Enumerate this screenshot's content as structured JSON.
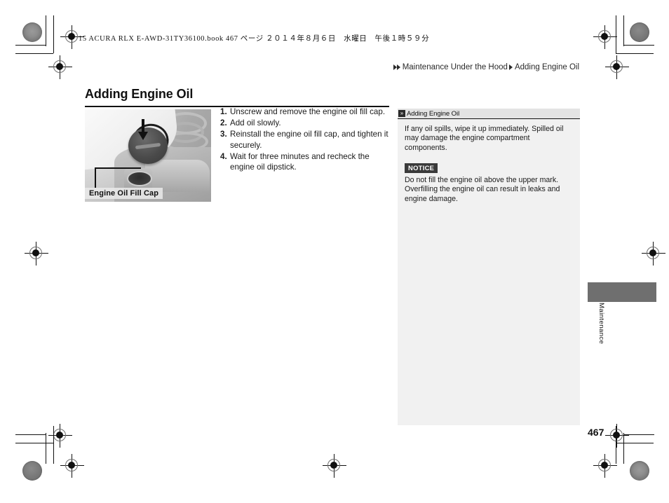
{
  "print_slug": {
    "plate_number": "15",
    "text": "15 ACURA RLX E-AWD-31TY36100.book   467 ページ   ２０１４年８月６日　水曜日　午後１時５９分"
  },
  "breadcrumb": {
    "items": [
      "Maintenance Under the Hood",
      "Adding Engine Oil"
    ],
    "separator_icon": "triangle-right-icon"
  },
  "page": {
    "title": "Adding Engine Oil",
    "number": "467"
  },
  "figure": {
    "caption": "Engine Oil Fill Cap",
    "alt_name": "engine-oil-fill-cap-photo",
    "callout_icon": "rotation-arrow-icon"
  },
  "steps": [
    {
      "num": "1.",
      "text": "Unscrew and remove the engine oil fill cap."
    },
    {
      "num": "2.",
      "text": "Add oil slowly."
    },
    {
      "num": "3.",
      "text": "Reinstall the engine oil fill cap, and tighten it securely."
    },
    {
      "num": "4.",
      "text": "Wait for three minutes and recheck the engine oil dipstick."
    }
  ],
  "side_panel": {
    "header_icon": "double-chevron-right-icon",
    "header_title": "Adding Engine Oil",
    "paragraph": "If any oil spills, wipe it up immediately. Spilled oil may damage the engine compartment components.",
    "notice_label": "NOTICE",
    "notice_text": "Do not fill the engine oil above the upper mark. Overfilling the engine oil can result in leaks and engine damage."
  },
  "thumb_tab": {
    "label": "Maintenance"
  },
  "colors": {
    "panel_bg": "#f1f1f1",
    "panel_header_bg": "#e3e3e3",
    "notice_bg": "#3a3a3a",
    "tab_gray": "#6f6f6f",
    "rule": "#111111"
  }
}
